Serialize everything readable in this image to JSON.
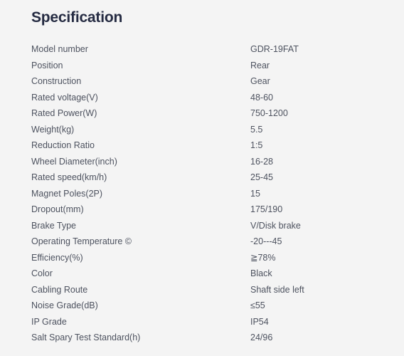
{
  "panel": {
    "title": "Specification",
    "background_color": "#f4f4f4",
    "title_color": "#252b42",
    "text_color": "#4d525f"
  },
  "rows": [
    {
      "label": "Model number",
      "value": "GDR-19FAT"
    },
    {
      "label": "Position",
      "value": "Rear"
    },
    {
      "label": "Construction",
      "value": "Gear"
    },
    {
      "label": "Rated voltage(V)",
      "value": "48-60"
    },
    {
      "label": "Rated Power(W)",
      "value": "750-1200"
    },
    {
      "label": "Weight(kg)",
      "value": "5.5"
    },
    {
      "label": "Reduction Ratio",
      "value": "1:5"
    },
    {
      "label": "Wheel Diameter(inch)",
      "value": "16-28"
    },
    {
      "label": "Rated speed(km/h)",
      "value": "25-45"
    },
    {
      "label": "Magnet Poles(2P)",
      "value": "15"
    },
    {
      "label": "Dropout(mm)",
      "value": "175/190"
    },
    {
      "label": "Brake Type",
      "value": "V/Disk brake"
    },
    {
      "label": "Operating Temperature ©",
      "value": "-20---45"
    },
    {
      "label": "Efficiency(%)",
      "value": "≧78%"
    },
    {
      "label": "Color",
      "value": "Black"
    },
    {
      "label": "Cabling Route",
      "value": "Shaft side left"
    },
    {
      "label": "Noise Grade(dB)",
      "value": "≤55"
    },
    {
      "label": "IP Grade",
      "value": "IP54"
    },
    {
      "label": "Salt Spary Test Standard(h)",
      "value": "24/96"
    }
  ]
}
